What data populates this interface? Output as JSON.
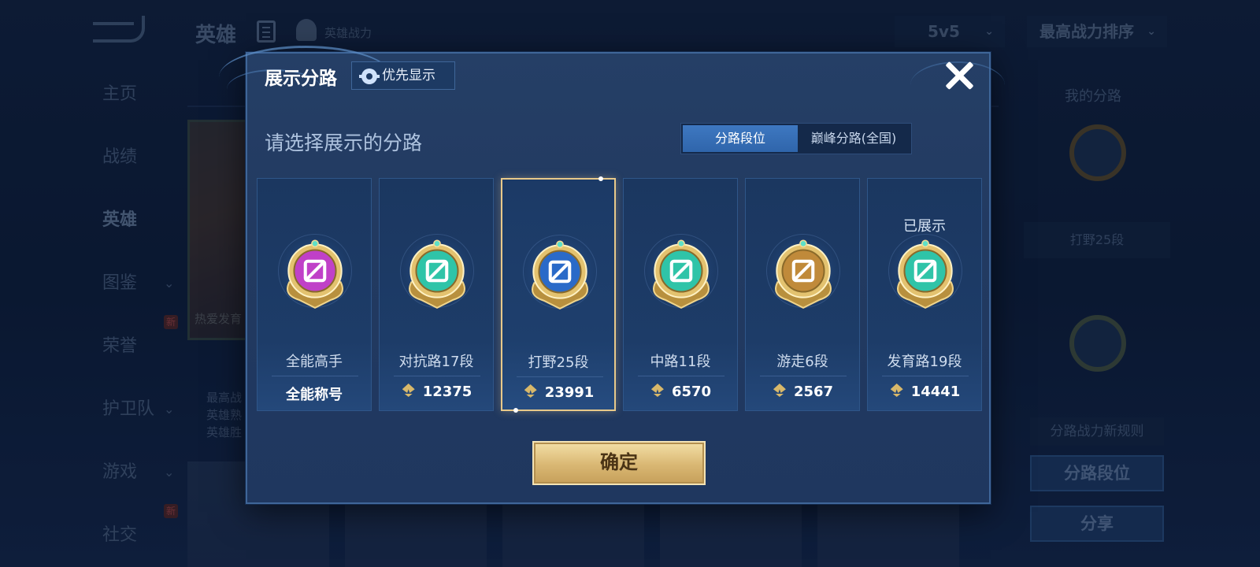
{
  "background": {
    "title": "英雄",
    "power_label": "英雄战力",
    "mode_select": "5v5",
    "sort_select": "最高战力排序",
    "sidebar": [
      {
        "label": "主页"
      },
      {
        "label": "战绩"
      },
      {
        "label": "英雄"
      },
      {
        "label": "图鉴"
      },
      {
        "label": "荣誉",
        "badge": "新"
      },
      {
        "label": "护卫队"
      },
      {
        "label": "游戏"
      },
      {
        "label": "社交",
        "badge": "新"
      }
    ],
    "hero_card_caption": "热爱发育",
    "stats_lines": [
      "最高战",
      "英雄熟",
      "英雄胜"
    ],
    "right_panel": {
      "title": "我的分路",
      "card_text": "打野25段",
      "rule": "分路战力新规则",
      "btn_rank": "分路段位",
      "btn_share": "分享"
    }
  },
  "modal": {
    "title": "展示分路",
    "priority_button": "优先显示",
    "subtitle": "请选择展示的分路",
    "tabs": [
      {
        "label": "分路段位",
        "active": true
      },
      {
        "label": "巅峰分路(全国)",
        "active": false
      }
    ],
    "shown_label": "已展示",
    "cards": [
      {
        "name": "全能高手",
        "value": "全能称号",
        "emblem": "allround-emblem",
        "color": "#c040c8",
        "show_power": false,
        "selected": false,
        "shown": false
      },
      {
        "name": "对抗路17段",
        "value": "12375",
        "emblem": "clash-lane-emblem",
        "color": "#2fc4a8",
        "show_power": true,
        "selected": false,
        "shown": false
      },
      {
        "name": "打野25段",
        "value": "23991",
        "emblem": "jungle-emblem",
        "color": "#2a6ac8",
        "show_power": true,
        "selected": true,
        "shown": false
      },
      {
        "name": "中路11段",
        "value": "6570",
        "emblem": "mid-lane-emblem",
        "color": "#2fc4a8",
        "show_power": true,
        "selected": false,
        "shown": false
      },
      {
        "name": "游走6段",
        "value": "2567",
        "emblem": "roam-emblem",
        "color": "#c08a3a",
        "show_power": true,
        "selected": false,
        "shown": false
      },
      {
        "name": "发育路19段",
        "value": "14441",
        "emblem": "farm-lane-emblem",
        "color": "#2fc4a8",
        "show_power": true,
        "selected": false,
        "shown": true
      }
    ],
    "confirm_button": "确定"
  }
}
